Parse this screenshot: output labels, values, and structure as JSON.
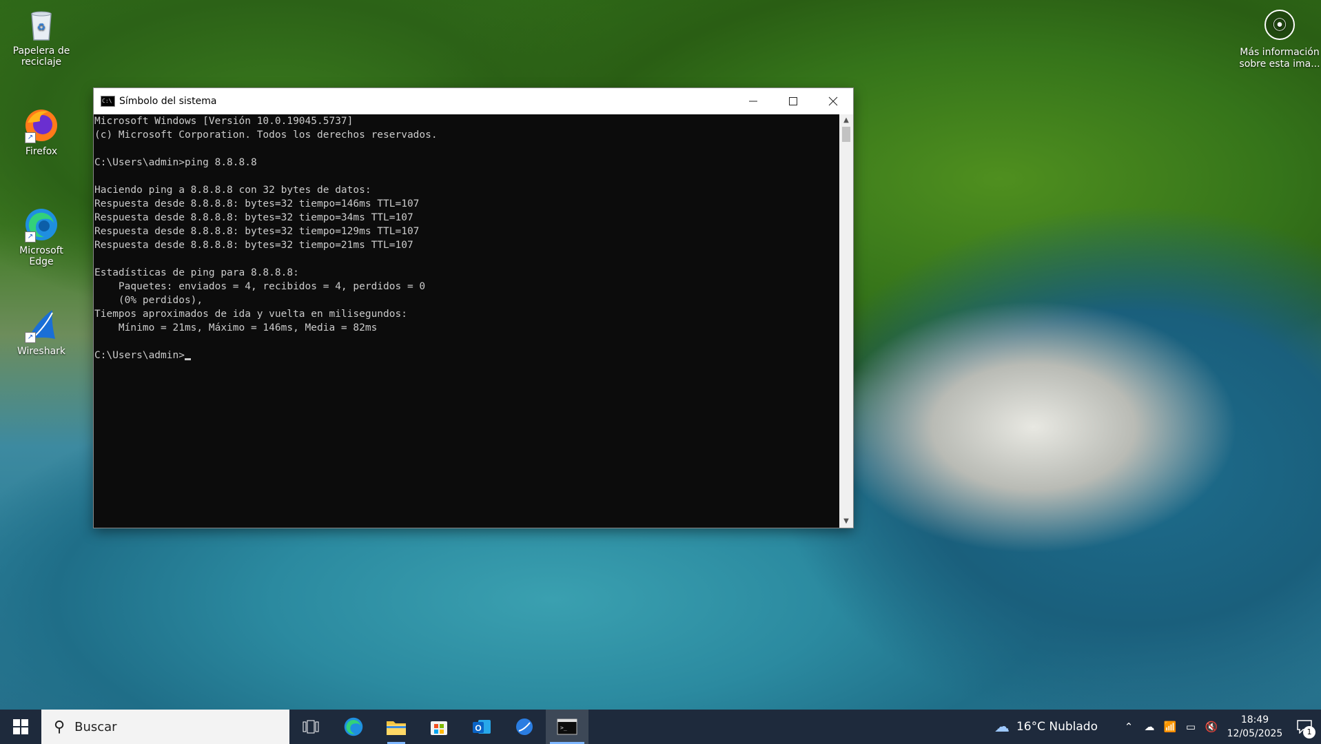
{
  "desktop": {
    "icons": [
      {
        "label": "Papelera de reciclaje",
        "icon": "recycle-bin-icon"
      },
      {
        "label": "Firefox",
        "icon": "firefox-icon"
      },
      {
        "label": "Microsoft Edge",
        "icon": "edge-icon"
      },
      {
        "label": "Wireshark",
        "icon": "wireshark-icon"
      }
    ],
    "info_label": "Más información sobre esta ima..."
  },
  "window": {
    "title": "Símbolo del sistema",
    "console_lines": [
      "Microsoft Windows [Versión 10.0.19045.5737]",
      "(c) Microsoft Corporation. Todos los derechos reservados.",
      "",
      "C:\\Users\\admin>ping 8.8.8.8",
      "",
      "Haciendo ping a 8.8.8.8 con 32 bytes de datos:",
      "Respuesta desde 8.8.8.8: bytes=32 tiempo=146ms TTL=107",
      "Respuesta desde 8.8.8.8: bytes=32 tiempo=34ms TTL=107",
      "Respuesta desde 8.8.8.8: bytes=32 tiempo=129ms TTL=107",
      "Respuesta desde 8.8.8.8: bytes=32 tiempo=21ms TTL=107",
      "",
      "Estadísticas de ping para 8.8.8.8:",
      "    Paquetes: enviados = 4, recibidos = 4, perdidos = 0",
      "    (0% perdidos),",
      "Tiempos aproximados de ida y vuelta en milisegundos:",
      "    Mínimo = 21ms, Máximo = 146ms, Media = 82ms",
      ""
    ],
    "prompt": "C:\\Users\\admin>"
  },
  "taskbar": {
    "search_placeholder": "Buscar",
    "apps": [
      "task-view-icon",
      "edge-icon",
      "file-explorer-icon",
      "store-icon",
      "outlook-icon",
      "wireshark-icon",
      "cmd-icon"
    ],
    "weather": "16°C  Nublado",
    "time": "18:49",
    "date": "12/05/2025",
    "notification_count": "1"
  }
}
